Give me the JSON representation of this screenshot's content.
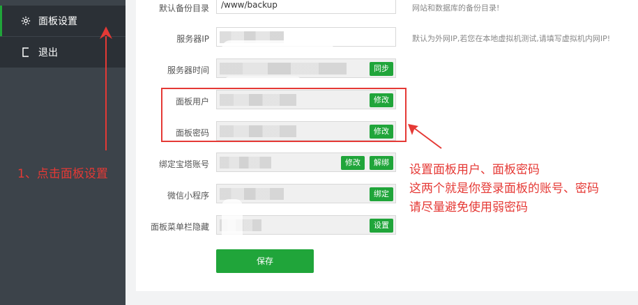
{
  "sidebar": {
    "items": [
      {
        "label": "面板设置",
        "icon": "gear-icon"
      },
      {
        "label": "退出",
        "icon": "logout-icon"
      }
    ]
  },
  "form": {
    "backup_dir": {
      "label": "默认备份目录",
      "value": "/www/backup",
      "hint": "网站和数据库的备份目录!"
    },
    "server_ip": {
      "label": "服务器IP",
      "hint": "默认为外网IP,若您在本地虚拟机测试,请填写虚拟机内网IP!"
    },
    "server_time": {
      "label": "服务器时间",
      "button": "同步"
    },
    "panel_user": {
      "label": "面板用户",
      "button": "修改"
    },
    "panel_password": {
      "label": "面板密码",
      "button": "修改"
    },
    "bt_account": {
      "label": "绑定宝塔账号",
      "button_edit": "修改",
      "button_unbind": "解绑"
    },
    "wechat_app": {
      "label": "微信小程序",
      "button": "绑定"
    },
    "menu_hide": {
      "label": "面板菜单栏隐藏",
      "button": "设置"
    },
    "save_label": "保存"
  },
  "annotations": {
    "step1": "1、点击面板设置",
    "note_line1": "设置面板用户、面板密码",
    "note_line2": "这两个就是你登录面板的账号、密码",
    "note_line3": "请尽量避免使用弱密码"
  },
  "colors": {
    "accent": "#20a53a",
    "annotation": "#e53935",
    "sidebar": "#3c434a"
  }
}
